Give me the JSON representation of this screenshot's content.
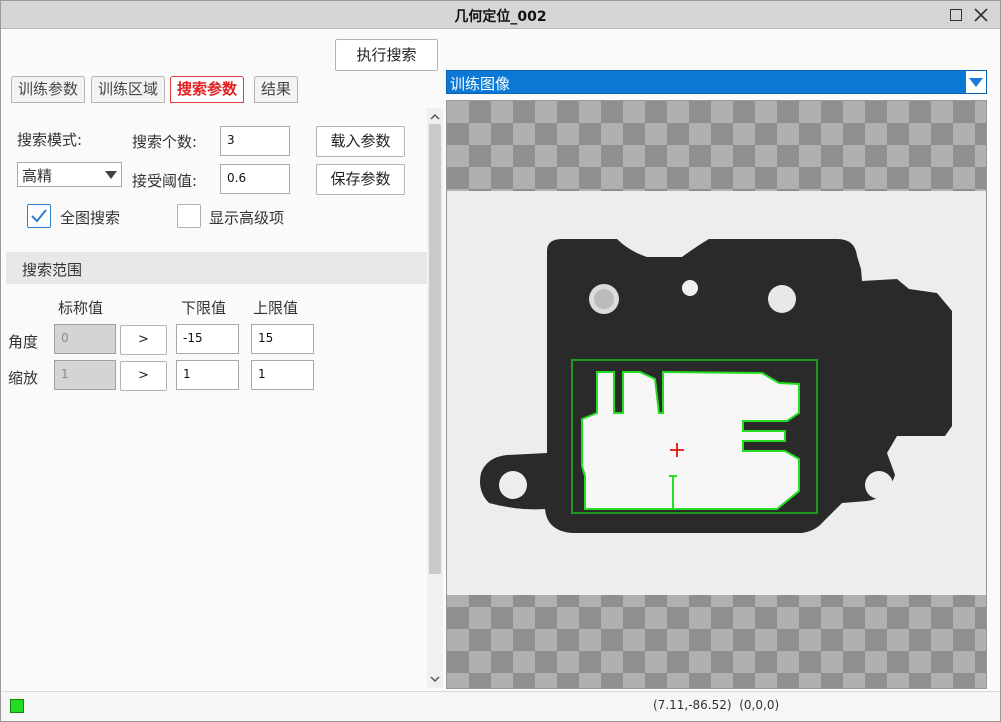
{
  "window": {
    "title": "几何定位_002"
  },
  "toolbar": {
    "run_search": "执行搜索"
  },
  "tabs": [
    {
      "label": "训练参数",
      "active": false
    },
    {
      "label": "训练区域",
      "active": false
    },
    {
      "label": "搜索参数",
      "active": true
    },
    {
      "label": "结果",
      "active": false
    }
  ],
  "search": {
    "mode_label": "搜索模式:",
    "mode_value": "高精",
    "count_label": "搜索个数:",
    "count_value": "3",
    "threshold_label": "接受阈值:",
    "threshold_value": "0.6",
    "load_button": "载入参数",
    "save_button": "保存参数",
    "full_image_label": "全图搜索",
    "full_image_checked": true,
    "advanced_label": "显示高级项",
    "advanced_checked": false
  },
  "range": {
    "section_title": "搜索范围",
    "col_nominal": "标称值",
    "col_lower": "下限值",
    "col_upper": "上限值",
    "rows": [
      {
        "label": "角度",
        "nominal": "0",
        "arrow": ">",
        "lower": "-15",
        "upper": "15"
      },
      {
        "label": "缩放",
        "nominal": "1",
        "arrow": ">",
        "lower": "1",
        "upper": "1"
      }
    ]
  },
  "image_view": {
    "selected": "训练图像",
    "colors": {
      "selection": "#0a78d4",
      "contour": "#22dd22",
      "roi": "#1f9a1f",
      "center": "#dd1111"
    }
  },
  "status": {
    "indicator_color": "#22dd22",
    "coords": "(7.11,-86.52)",
    "pixel": "(0,0,0)"
  }
}
